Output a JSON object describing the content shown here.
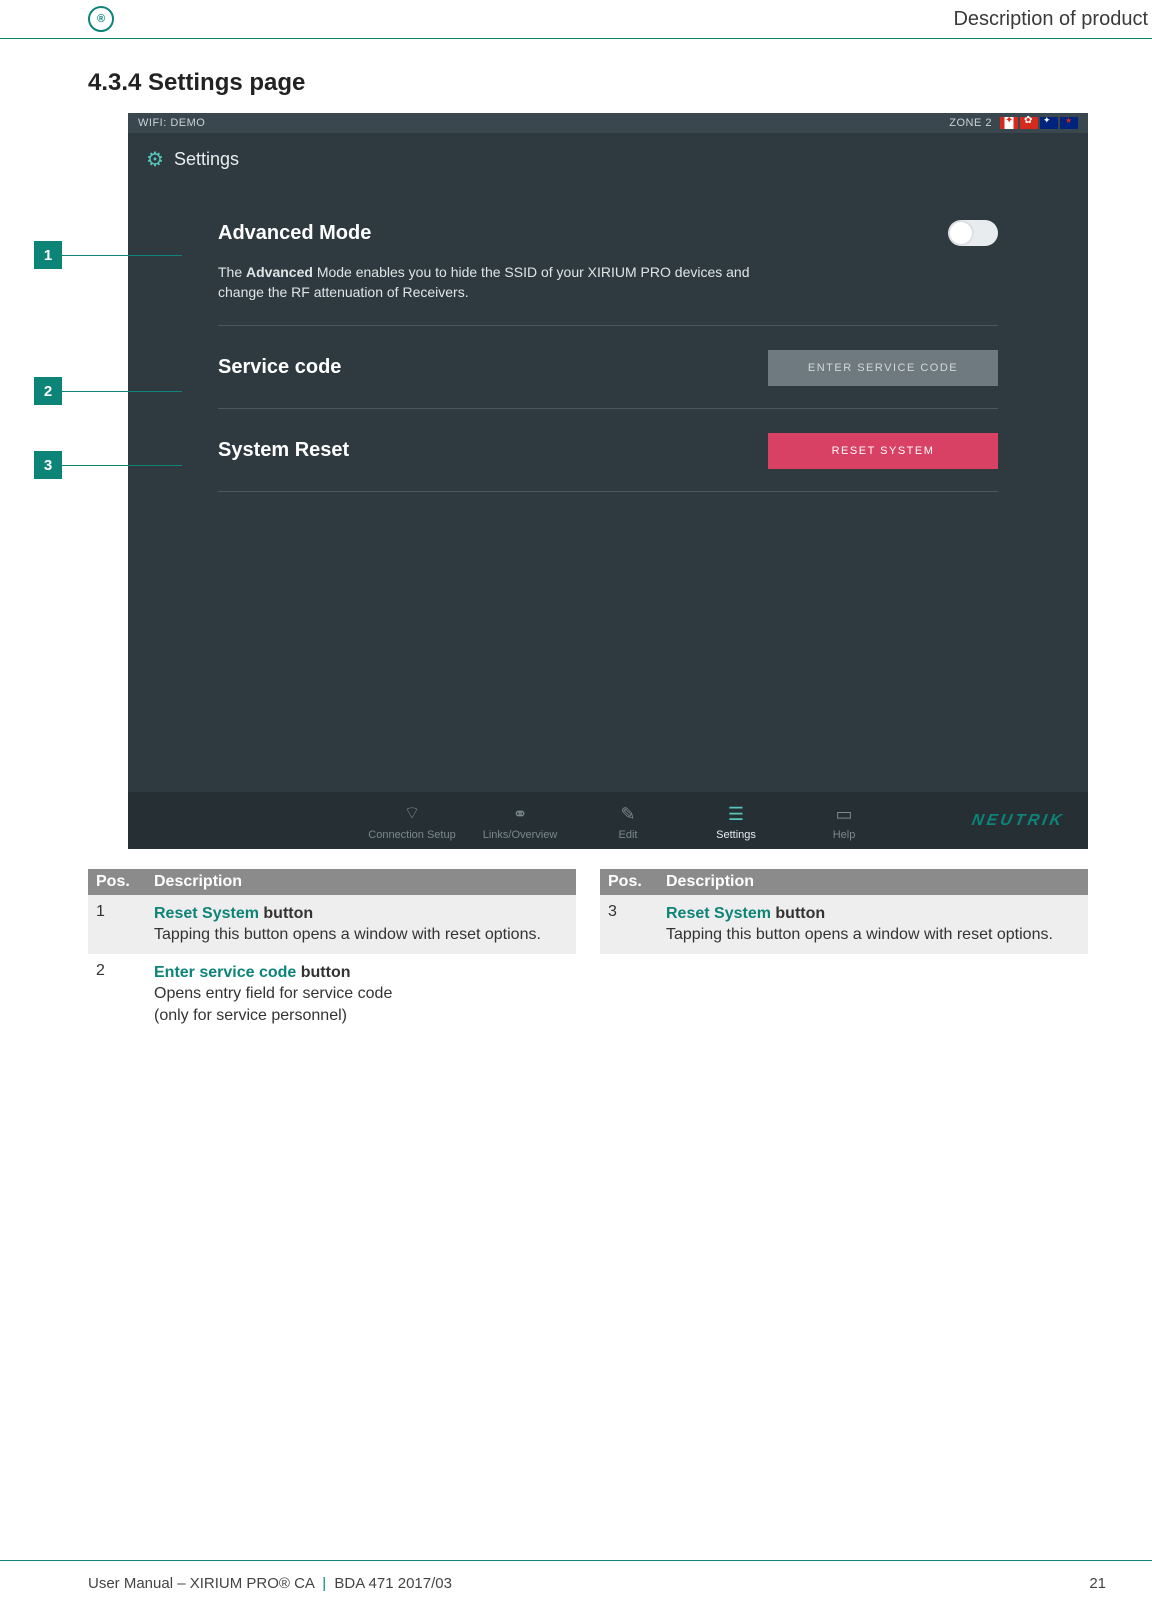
{
  "header": {
    "right_label": "Description of product"
  },
  "section_title": "4.3.4 Settings page",
  "callouts": [
    {
      "num": "1"
    },
    {
      "num": "2"
    },
    {
      "num": "3"
    }
  ],
  "app": {
    "status": {
      "left": "WIFI: DEMO",
      "zone": "ZONE 2"
    },
    "title": "Settings",
    "advanced": {
      "title": "Advanced Mode",
      "desc_pre": "The ",
      "desc_bold": "Advanced",
      "desc_post": " Mode enables you to hide the SSID of your XIRIUM PRO devices and change the RF attenuation of Receivers."
    },
    "service": {
      "title": "Service code",
      "button": "ENTER SERVICE CODE"
    },
    "reset": {
      "title": "System Reset",
      "button": "RESET SYSTEM"
    },
    "nav": {
      "conn": "Connection Setup",
      "links": "Links/Overview",
      "edit": "Edit",
      "settings": "Settings",
      "help": "Help"
    },
    "brand": "NEUTRIK"
  },
  "tables": {
    "headers": {
      "pos": "Pos.",
      "desc": "Description"
    },
    "left": [
      {
        "pos": "1",
        "title_colored": "Reset System",
        "title_rest": " button",
        "body": "Tapping this button opens a window with reset options."
      },
      {
        "pos": "2",
        "title_colored": "Enter service code",
        "title_rest": " button",
        "body": "Opens entry field for service code",
        "body2": "(only for service personnel)"
      }
    ],
    "right": [
      {
        "pos": "3",
        "title_colored": "Reset System",
        "title_rest": " button",
        "body": "Tapping this button opens a window with reset options."
      }
    ]
  },
  "footer": {
    "product": "User Manual – XIRIUM PRO® CA",
    "doc": "BDA 471 2017/03",
    "page": "21"
  }
}
